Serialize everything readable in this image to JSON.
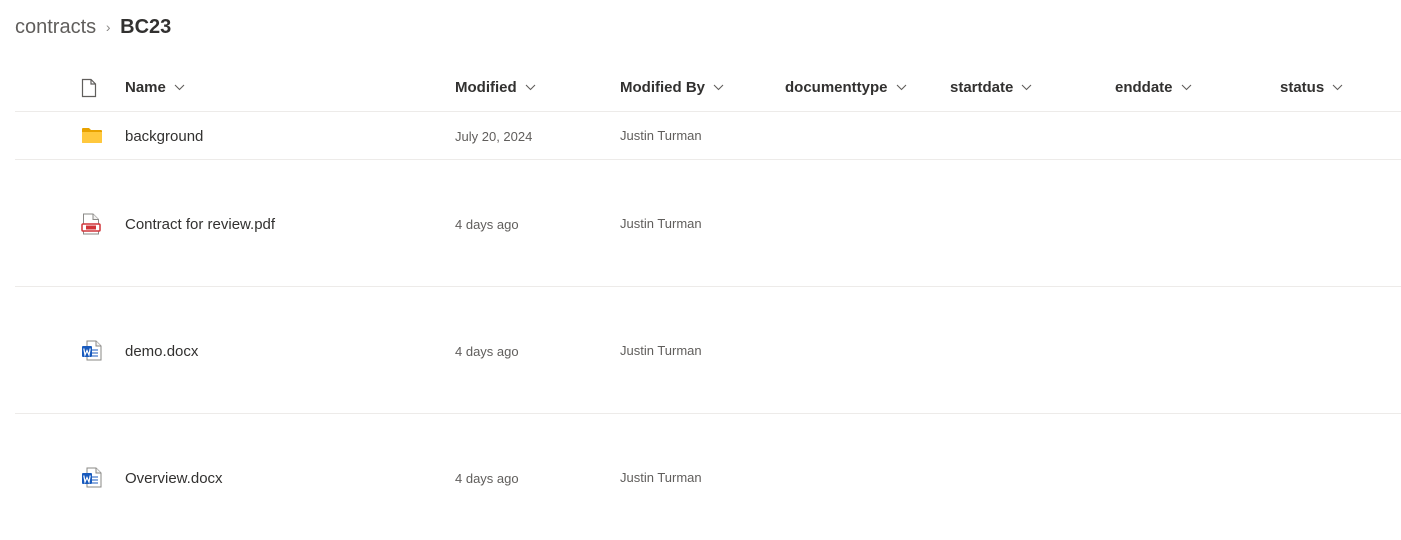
{
  "breadcrumb": {
    "parent": "contracts",
    "separator": "›",
    "current": "BC23"
  },
  "columns": {
    "name": "Name",
    "modified": "Modified",
    "modified_by": "Modified By",
    "documenttype": "documenttype",
    "startdate": "startdate",
    "enddate": "enddate",
    "status": "status"
  },
  "files": [
    {
      "icon": "folder-icon",
      "name": "background",
      "modified": "July 20, 2024",
      "modified_by": "Justin Turman"
    },
    {
      "icon": "pdf-file-icon",
      "name": "Contract for review.pdf",
      "modified": "4 days ago",
      "modified_by": "Justin Turman"
    },
    {
      "icon": "word-file-icon",
      "name": "demo.docx",
      "modified": "4 days ago",
      "modified_by": "Justin Turman"
    },
    {
      "icon": "word-file-icon",
      "name": "Overview.docx",
      "modified": "4 days ago",
      "modified_by": "Justin Turman"
    }
  ],
  "colors": {
    "folder": "#FFB900",
    "pdf": "#D13438",
    "word": "#185ABD",
    "divider": "#EDEBE9"
  }
}
